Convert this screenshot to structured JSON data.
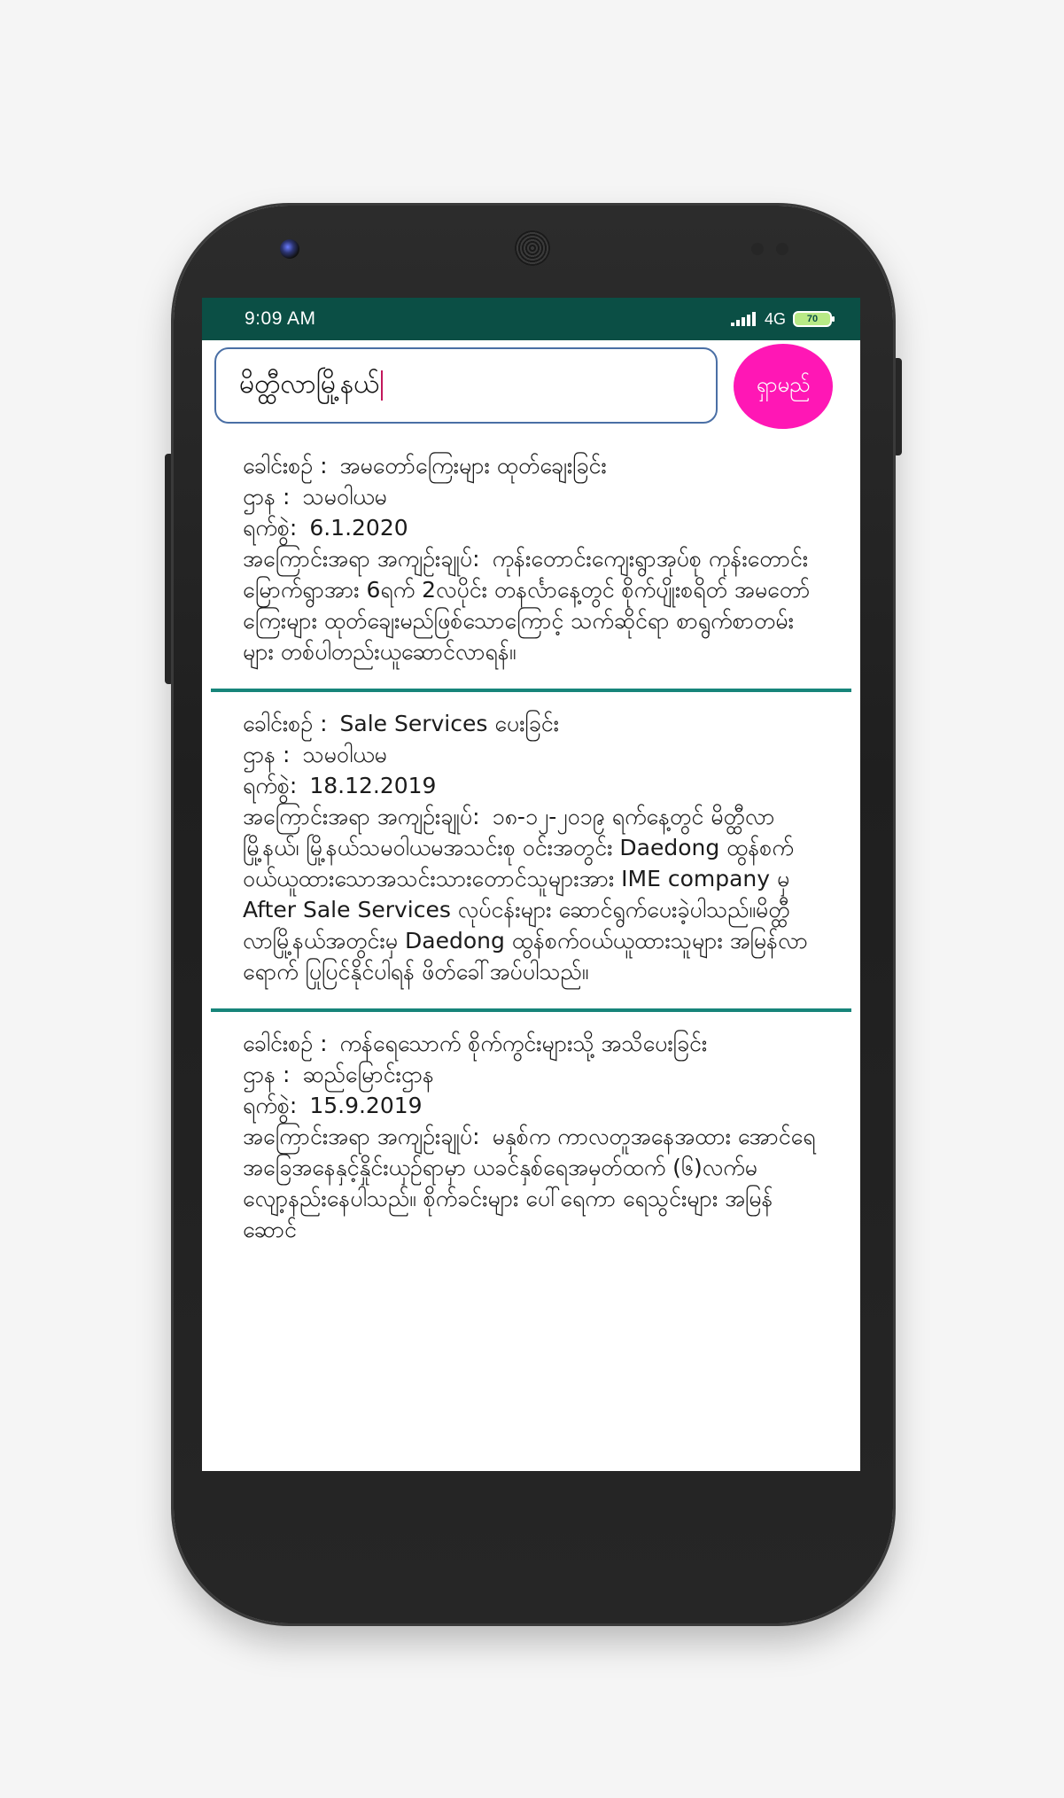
{
  "status_bar": {
    "time": "9:09 AM",
    "network": "4G",
    "battery": "70"
  },
  "search": {
    "value": "မိတ္ထီလာမြို့နယ်",
    "button_label": "ရှာမည်"
  },
  "labels": {
    "title": "ခေါင်းစဥ် :",
    "department": "ဌာန :",
    "date": "ရက်စွဲ:",
    "summary": "အကြောင်းအရာ အကျဥ်းချုပ်:"
  },
  "results": [
    {
      "title": "အမတော်ကြေးများ ထုတ်ချေးခြင်း",
      "department": "သမဝါယမ",
      "date": "6.1.2020",
      "summary": "ကုန်းတောင်းကျေးရွာအုပ်စု ကုန်းတောင်းမြောက်ရွာအား 6ရက် 2လပိုင်း တနင်္လာနေ့တွင် စိုက်ပျိုးစရိတ် အမတော်ကြေးများ ထုတ်ချေးမည်ဖြစ်သောကြောင့် သက်ဆိုင်ရာ စာရွက်စာတမ်းများ တစ်ပါတည်းယူဆောင်လာရန်။"
    },
    {
      "title": "Sale Services ပေးခြင်း",
      "department": "သမဝါယမ",
      "date": "18.12.2019",
      "summary": "၁၈-၁၂-၂၀၁၉ ရက်နေ့တွင် မိတ္ထီလာမြို့နယ်၊ မြို့နယ်သမဝါယမအသင်းစု ဝင်းအတွင်း Daedong ထွန်စက်ဝယ်ယူထားသောအသင်းသားတောင်သူများအား IME company မှ After Sale Services လုပ်ငန်းများ ဆောင်ရွက်ပေးခဲ့ပါသည်။မိတ္ထီလာမြို့နယ်အတွင်းမှ Daedong ထွန်စက်ဝယ်ယူထားသူများ အမြန်လာရောက် ပြုပြင်နိုင်ပါရန် ဖိတ်ခေါ်အပ်ပါသည်။"
    },
    {
      "title": "ကန်ရေသောက် စိုက်ကွင်းများသို့ အသိပေးခြင်း",
      "department": "ဆည်မြောင်းဌာန",
      "date": "15.9.2019",
      "summary": "မနှစ်က ကာလတူအနေအထား အောင်ရေအခြေအနေနှင့်နှိုင်းယှဥ်ရာမှာ ယခင်နှစ်ရေအမှတ်ထက် (၆)လက်မ လျော့နည်းနေပါသည်။ စိုက်ခင်းများ ပေါ်ရေကာ ရေသွင်းများ အမြန်ဆောင်"
    }
  ]
}
